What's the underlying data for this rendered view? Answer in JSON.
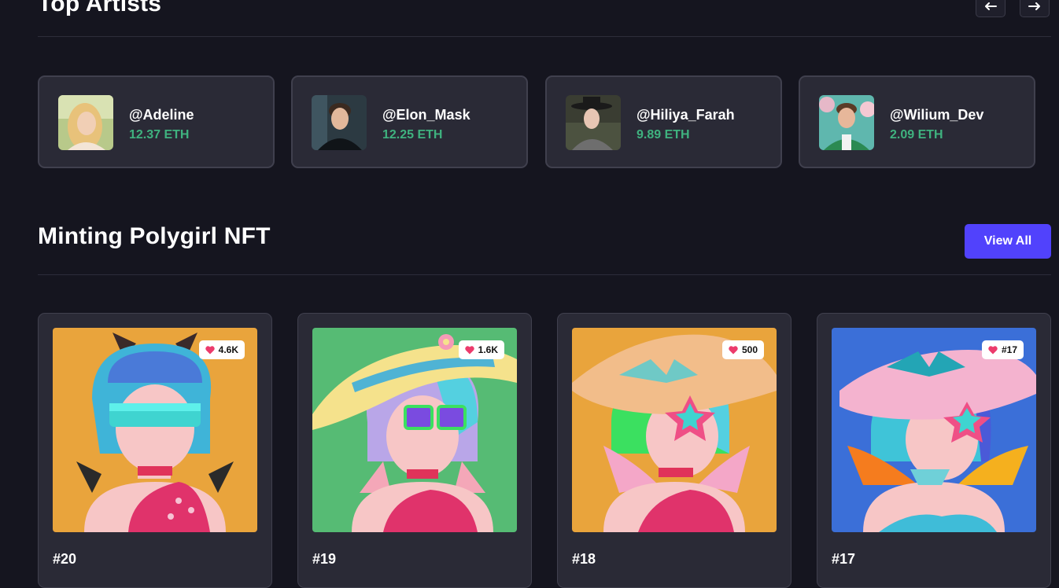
{
  "top_artists": {
    "title": "Top Artists",
    "prev_icon": "arrow-left-icon",
    "next_icon": "arrow-right-icon",
    "artists": [
      {
        "name": "@Adeline",
        "eth": "12.37 ETH"
      },
      {
        "name": "@Elon_Mask",
        "eth": "12.25 ETH"
      },
      {
        "name": "@Hiliya_Farah",
        "eth": "9.89 ETH"
      },
      {
        "name": "@Wilium_Dev",
        "eth": "2.09 ETH"
      }
    ]
  },
  "minting": {
    "title": "Minting Polygirl NFT",
    "view_all_label": "View All",
    "nfts": [
      {
        "title": "#20",
        "likes": "4.6K",
        "background": "#e9a43c"
      },
      {
        "title": "#19",
        "likes": "1.6K",
        "background": "#56bb74"
      },
      {
        "title": "#18",
        "likes": "500",
        "background": "#e9a43c"
      },
      {
        "title": "#17",
        "likes": "#17",
        "background": "#3b6fd8"
      }
    ]
  },
  "colors": {
    "page_bg": "#15151f",
    "card_bg": "#2a2a36",
    "eth_green": "#3fb27f",
    "accent": "#5142fc",
    "heart": "#ec3b6c"
  }
}
